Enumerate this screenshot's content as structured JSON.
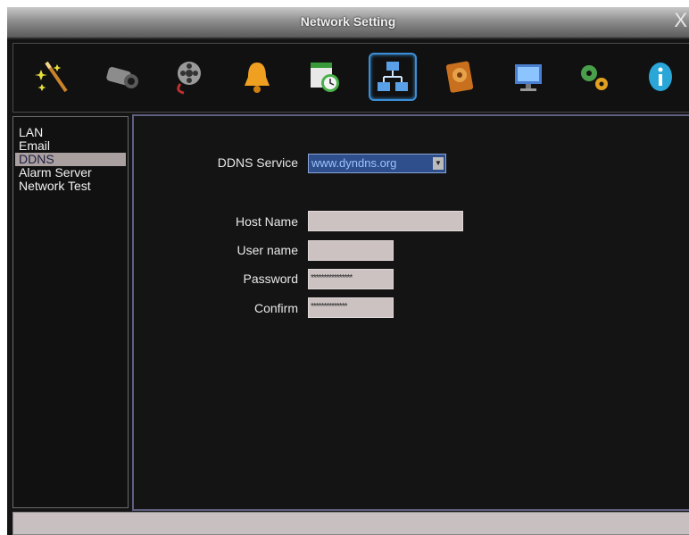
{
  "window": {
    "title": "Network Setting",
    "close_glyph": "X"
  },
  "toolbar": {
    "active_index": 5,
    "icons": [
      {
        "name": "wizard-wand-icon"
      },
      {
        "name": "camera-icon"
      },
      {
        "name": "film-reel-icon"
      },
      {
        "name": "alarm-bell-icon"
      },
      {
        "name": "schedule-clock-icon"
      },
      {
        "name": "network-icon"
      },
      {
        "name": "hard-disk-icon"
      },
      {
        "name": "monitor-icon"
      },
      {
        "name": "gears-icon"
      },
      {
        "name": "info-icon"
      }
    ]
  },
  "sidebar": {
    "items": [
      {
        "label": "LAN"
      },
      {
        "label": "Email"
      },
      {
        "label": "DDNS",
        "selected": true
      },
      {
        "label": "Alarm Server"
      },
      {
        "label": "Network Test"
      }
    ]
  },
  "form": {
    "ddns_service_label": "DDNS Service",
    "ddns_service_value": "www.dyndns.org",
    "host_name_label": "Host Name",
    "host_name_value": "",
    "user_name_label": "User name",
    "user_name_value": "",
    "password_label": "Password",
    "password_value": "****************",
    "confirm_label": "Confirm",
    "confirm_value": "**************"
  },
  "colors": {
    "background": "#141414",
    "selected_item": "#aaa0a0",
    "select_bg": "#2e4f8c",
    "field_bg": "#ccc2c2",
    "active_tool_border": "#3b8fd6"
  }
}
